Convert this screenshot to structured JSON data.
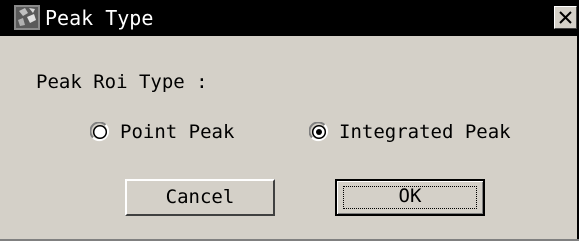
{
  "window": {
    "title": "Peak Type",
    "app_icon": "app-icon",
    "close_icon": "close-x-icon"
  },
  "form": {
    "roi_label": "Peak Roi Type :",
    "options": [
      {
        "label": "Point Peak",
        "selected": false
      },
      {
        "label": "Integrated Peak",
        "selected": true
      }
    ]
  },
  "buttons": {
    "cancel_label": "Cancel",
    "ok_label": "OK",
    "default": "ok"
  },
  "colors": {
    "title_bar": "#000000",
    "dialog_face": "#d4d0c8",
    "text": "#000000"
  }
}
